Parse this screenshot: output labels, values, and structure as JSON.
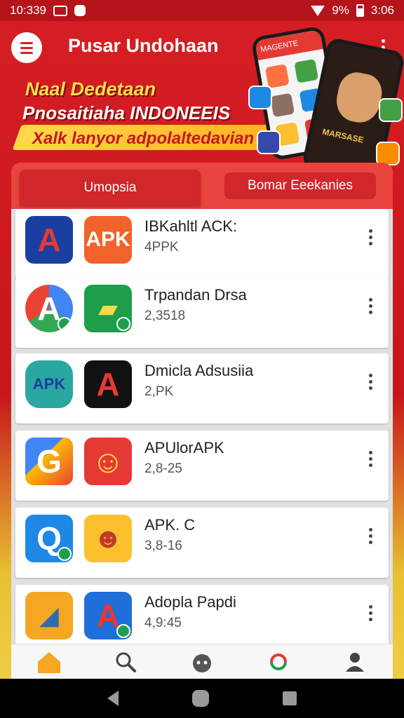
{
  "status_bar": {
    "time": "10:339",
    "battery_text": "9%",
    "clock_right": "3:06"
  },
  "app_bar": {
    "title": "Pusar Undohaan",
    "menu_icon": "hamburger-menu-icon",
    "more_icon": "more-vert-icon"
  },
  "banner": {
    "line1": "Naal Dedetaan",
    "line2": "Pnosaitiaha INDONEEIS",
    "line3": "Xalk lanyor adpolaltedavian",
    "phone_caption": "MARSASE",
    "phone_header": "MAGENTE"
  },
  "tabs": [
    {
      "label": "Umopsia",
      "active": true
    },
    {
      "label": "Bomar Eeekanies",
      "active": false
    }
  ],
  "apps": [
    {
      "title": "IBKahltl ACK:",
      "subtitle": "4PPK",
      "icon_a": "red-a-logo-icon",
      "icon_b": "apk-logo-icon"
    },
    {
      "title": "Trpandan Drsa",
      "subtitle": "2,3518",
      "icon_a": "google-drive-icon",
      "icon_b": "green-folder-icon"
    },
    {
      "title": "Dmicla Adsusiia",
      "subtitle": "2,PK",
      "icon_a": "android-monster-icon",
      "icon_b": "black-a-logo-icon"
    },
    {
      "title": "APUlorAPK",
      "subtitle": "2,8-25",
      "icon_a": "colorful-swirl-icon",
      "icon_b": "smiley-cat-icon"
    },
    {
      "title": "APK. C",
      "subtitle": "3,8-16",
      "icon_a": "search-tool-icon",
      "icon_b": "cartoon-character-icon"
    },
    {
      "title": "Adopla Papdi",
      "subtitle": "4,9:45",
      "icon_a": "gold-folder-icon",
      "icon_b": "blue-a-logo-icon"
    }
  ],
  "bottom_nav": [
    {
      "icon": "home-icon"
    },
    {
      "icon": "search-icon"
    },
    {
      "icon": "mascot-icon"
    },
    {
      "icon": "sync-icon"
    },
    {
      "icon": "profile-icon"
    }
  ],
  "colors": {
    "primary_red": "#d61f24",
    "accent_yellow": "#ffd84a",
    "card_bg": "#ffffff"
  }
}
